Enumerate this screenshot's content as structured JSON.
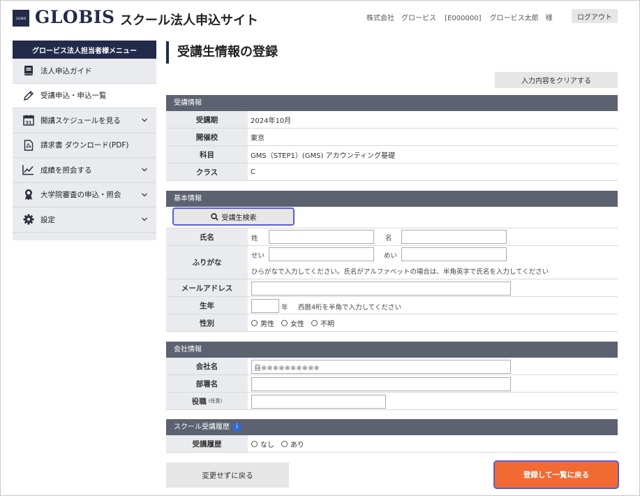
{
  "header": {
    "logo_small_text": "GLOBIS",
    "brand": "GLOBIS",
    "site_title": "スクール法人申込サイト",
    "company": "株式会社　グロービス",
    "company_id": "[E000000]",
    "user_name": "グロービス太郎　様",
    "logout_label": "ログアウト"
  },
  "sidebar": {
    "heading": "グロービス法人担当者様メニュー",
    "items": [
      {
        "label": "法人申込ガイド",
        "icon": "book-icon"
      },
      {
        "label": "受講申込・申込一覧",
        "icon": "pencil-icon"
      },
      {
        "label": "開講スケジュールを見る",
        "icon": "calendar-icon",
        "calendar_day": "31"
      },
      {
        "label": "請求書 ダウンロード(PDF)",
        "icon": "pdf-file-icon"
      },
      {
        "label": "成績を照会する",
        "icon": "chart-line-icon"
      },
      {
        "label": "大学院審査の申込・照会",
        "icon": "award-ribbon-icon"
      },
      {
        "label": "設定",
        "icon": "gear-icon"
      }
    ]
  },
  "main": {
    "page_title": "受講生情報の登録",
    "clear_label": "入力内容をクリアする",
    "course_section": {
      "title": "受講情報",
      "rows": [
        {
          "label": "受講期",
          "value": "2024年10月"
        },
        {
          "label": "開催校",
          "value": "東京"
        },
        {
          "label": "科目",
          "value": "GMS（STEP1）(GMS) アカウンティング基礎"
        },
        {
          "label": "クラス",
          "value": "C"
        }
      ]
    },
    "basic_section": {
      "title": "基本情報",
      "search_label": "受講生検索",
      "name_label": "氏名",
      "last_name_label": "姓",
      "first_name_label": "名",
      "kana_label": "ふりがな",
      "last_kana_label": "せい",
      "first_kana_label": "めい",
      "kana_note": "ひらがなで入力してください。氏名がアルファベットの場合は、半角英字で氏名を入力してください",
      "email_label": "メールアドレス",
      "birth_label": "生年",
      "year_unit": "年",
      "birth_note": "西暦4桁を半角で入力してください",
      "gender_label": "性別",
      "gender_options": [
        "男性",
        "女性",
        "不明"
      ]
    },
    "company_section": {
      "title": "会社情報",
      "company_label": "会社名",
      "company_value": "自※※※※※※※※※※",
      "department_label": "部署名",
      "position_label": "役職",
      "position_note": "(任意)"
    },
    "history_section": {
      "title": "スクール受講履歴",
      "info_glyph": "i",
      "history_label": "受講履歴",
      "options": [
        "なし",
        "あり"
      ]
    },
    "back_label": "変更せずに戻る",
    "submit_label": "登録して一覧に戻る"
  },
  "colors": {
    "navy": "#222b4a",
    "section_header": "#5c6270",
    "accent_orange": "#f26a33",
    "focus_outline": "#5b5bd6"
  }
}
